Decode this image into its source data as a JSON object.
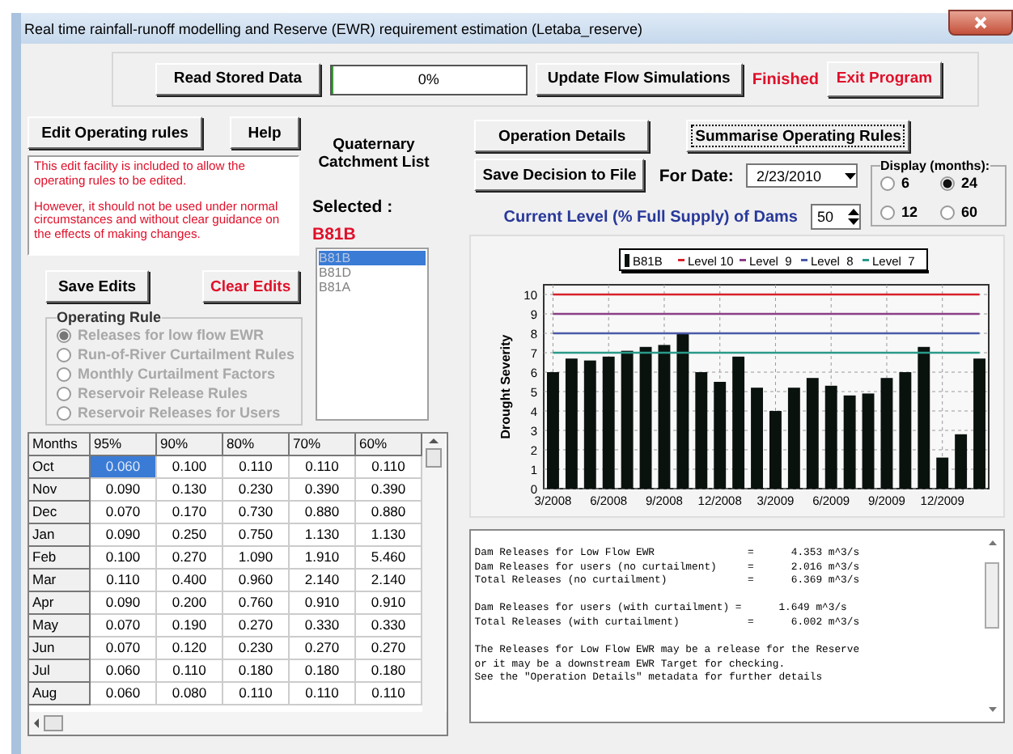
{
  "window": {
    "title": "Real time rainfall-runoff modelling and Reserve (EWR) requirement estimation (Letaba_reserve)"
  },
  "top_bar": {
    "read_button": "Read Stored Data",
    "progress": {
      "text": "0%",
      "level": 0
    },
    "update_button": "Update Flow Simulations",
    "status": "Finished",
    "exit_button": "Exit Program"
  },
  "edit_buttons": [
    "Edit Operating rules",
    "Help"
  ],
  "notice": [
    "This edit facility is included to allow the operating rules to be edited.",
    "However, it should not be used under normal circumstances and without clear guidance on the effects of making changes."
  ],
  "save_button": "Save Edits",
  "clear_button": "Clear Edits",
  "operating_rule": {
    "title": "Operating Rule",
    "options": [
      {
        "label": "Releases for low flow EWR",
        "selected": true,
        "disabled": true
      },
      {
        "label": "Run-of-River Curtailment Rules",
        "selected": false,
        "disabled": true
      },
      {
        "label": "Monthly Curtailment Factors",
        "selected": false,
        "disabled": true
      },
      {
        "label": "Reservoir Release Rules",
        "selected": false,
        "disabled": true
      },
      {
        "label": "Reservoir Releases for Users",
        "selected": false,
        "disabled": true
      }
    ]
  },
  "catchment": {
    "title": "Quaternary Catchment List",
    "selected_label": "Selected :",
    "selected_value": "B81B",
    "items": [
      {
        "label": "B81B",
        "selected": true
      },
      {
        "label": "B81D",
        "selected": false
      },
      {
        "label": "B81A",
        "selected": false
      }
    ]
  },
  "table": {
    "columns": [
      "Months",
      "95%",
      "90%",
      "80%",
      "70%",
      "60%"
    ],
    "rows": [
      {
        "month": "Oct",
        "cells": [
          {
            "v": "0.060",
            "selected": true
          },
          {
            "v": "0.100",
            "selected": false
          },
          {
            "v": "0.110",
            "selected": false
          },
          {
            "v": "0.110",
            "selected": false
          },
          {
            "v": "0.110",
            "selected": false
          }
        ]
      },
      {
        "month": "Nov",
        "cells": [
          {
            "v": "0.090",
            "selected": false
          },
          {
            "v": "0.130",
            "selected": false
          },
          {
            "v": "0.230",
            "selected": false
          },
          {
            "v": "0.390",
            "selected": false
          },
          {
            "v": "0.390",
            "selected": false
          }
        ]
      },
      {
        "month": "Dec",
        "cells": [
          {
            "v": "0.070",
            "selected": false
          },
          {
            "v": "0.170",
            "selected": false
          },
          {
            "v": "0.730",
            "selected": false
          },
          {
            "v": "0.880",
            "selected": false
          },
          {
            "v": "0.880",
            "selected": false
          }
        ]
      },
      {
        "month": "Jan",
        "cells": [
          {
            "v": "0.090",
            "selected": false
          },
          {
            "v": "0.250",
            "selected": false
          },
          {
            "v": "0.750",
            "selected": false
          },
          {
            "v": "1.130",
            "selected": false
          },
          {
            "v": "1.130",
            "selected": false
          }
        ]
      },
      {
        "month": "Feb",
        "cells": [
          {
            "v": "0.100",
            "selected": false
          },
          {
            "v": "0.270",
            "selected": false
          },
          {
            "v": "1.090",
            "selected": false
          },
          {
            "v": "1.910",
            "selected": false
          },
          {
            "v": "5.460",
            "selected": false
          }
        ]
      },
      {
        "month": "Mar",
        "cells": [
          {
            "v": "0.110",
            "selected": false
          },
          {
            "v": "0.400",
            "selected": false
          },
          {
            "v": "0.960",
            "selected": false
          },
          {
            "v": "2.140",
            "selected": false
          },
          {
            "v": "2.140",
            "selected": false
          }
        ]
      },
      {
        "month": "Apr",
        "cells": [
          {
            "v": "0.090",
            "selected": false
          },
          {
            "v": "0.200",
            "selected": false
          },
          {
            "v": "0.760",
            "selected": false
          },
          {
            "v": "0.910",
            "selected": false
          },
          {
            "v": "0.910",
            "selected": false
          }
        ]
      },
      {
        "month": "May",
        "cells": [
          {
            "v": "0.070",
            "selected": false
          },
          {
            "v": "0.190",
            "selected": false
          },
          {
            "v": "0.270",
            "selected": false
          },
          {
            "v": "0.330",
            "selected": false
          },
          {
            "v": "0.330",
            "selected": false
          }
        ]
      },
      {
        "month": "Jun",
        "cells": [
          {
            "v": "0.070",
            "selected": false
          },
          {
            "v": "0.120",
            "selected": false
          },
          {
            "v": "0.230",
            "selected": false
          },
          {
            "v": "0.270",
            "selected": false
          },
          {
            "v": "0.270",
            "selected": false
          }
        ]
      },
      {
        "month": "Jul",
        "cells": [
          {
            "v": "0.060",
            "selected": false
          },
          {
            "v": "0.110",
            "selected": false
          },
          {
            "v": "0.180",
            "selected": false
          },
          {
            "v": "0.180",
            "selected": false
          },
          {
            "v": "0.180",
            "selected": false
          }
        ]
      },
      {
        "month": "Aug",
        "cells": [
          {
            "v": "0.060",
            "selected": false
          },
          {
            "v": "0.080",
            "selected": false
          },
          {
            "v": "0.110",
            "selected": false
          },
          {
            "v": "0.110",
            "selected": false
          },
          {
            "v": "0.110",
            "selected": false
          }
        ]
      }
    ]
  },
  "right_buttons": [
    "Operation Details",
    "Summarise Operating Rules"
  ],
  "save_decision_button": "Save Decision to File",
  "date": {
    "label": "For Date:",
    "value": "2/23/2010"
  },
  "display": {
    "title": "Display (months):",
    "options": [
      {
        "label": "6",
        "selected": false
      },
      {
        "label": "24",
        "selected": true
      },
      {
        "label": "12",
        "selected": false
      },
      {
        "label": "60",
        "selected": false
      }
    ]
  },
  "dam_level": {
    "label": "Current Level (% Full Supply) of Dams",
    "value": "50"
  },
  "chart": {
    "chart_data": {
      "type": "bar",
      "ylabel": "Drought Severity",
      "categories": [
        "3/2008",
        null,
        null,
        "6/2008",
        null,
        null,
        "9/2008",
        null,
        null,
        "12/2008",
        null,
        null,
        "3/2009",
        null,
        null,
        "6/2009",
        null,
        null,
        "9/2009",
        null,
        null,
        "12/2009",
        null,
        null
      ],
      "yticks": [
        0,
        1,
        2,
        3,
        4,
        5,
        6,
        7,
        8,
        9,
        10
      ],
      "ylim": [
        0,
        10.5
      ],
      "grid": true,
      "legend": true,
      "series": [
        {
          "name": "B81B",
          "color": "#0a120e",
          "values": [
            6.0,
            6.7,
            6.6,
            6.8,
            7.1,
            7.3,
            7.4,
            8.0,
            6.0,
            5.5,
            6.8,
            5.2,
            4.0,
            5.2,
            5.7,
            5.3,
            4.8,
            4.9,
            5.7,
            6.0,
            7.3,
            1.6,
            2.8,
            6.7
          ]
        },
        {
          "name": "Level 10",
          "type": "line",
          "color": "#d8202c",
          "values": [
            10,
            10,
            10,
            10,
            10,
            10,
            10,
            10,
            10,
            10,
            10,
            10,
            10,
            10,
            10,
            10,
            10,
            10,
            10,
            10,
            10,
            10,
            10,
            10
          ]
        },
        {
          "name": "Level  9",
          "type": "line",
          "color": "#8a3f86",
          "values": [
            9,
            9,
            9,
            9,
            9,
            9,
            9,
            9,
            9,
            9,
            9,
            9,
            9,
            9,
            9,
            9,
            9,
            9,
            9,
            9,
            9,
            9,
            9,
            9
          ]
        },
        {
          "name": "Level  8",
          "type": "line",
          "color": "#4a5aa8",
          "values": [
            8,
            8,
            8,
            8,
            8,
            8,
            8,
            8,
            8,
            8,
            8,
            8,
            8,
            8,
            8,
            8,
            8,
            8,
            8,
            8,
            8,
            8,
            8,
            8
          ]
        },
        {
          "name": "Level  7",
          "type": "line",
          "color": "#2a9a8a",
          "values": [
            7,
            7,
            7,
            7,
            7,
            7,
            7,
            7,
            7,
            7,
            7,
            7,
            7,
            7,
            7,
            7,
            7,
            7,
            7,
            7,
            7,
            7,
            7,
            7
          ]
        }
      ]
    }
  },
  "output": [
    [
      "Dam Releases for Low Flow EWR               =      4.353 m^3/s",
      "Dam Releases for users (no curtailment)     =      2.016 m^3/s",
      "Total Releases (no curtailment)             =      6.369 m^3/s"
    ],
    [
      "Dam Releases for users (with curtailment) =      1.649 m^3/s",
      "Total Releases (with curtailment)           =      6.002 m^3/s"
    ],
    [
      "The Releases for Low Flow EWR may be a release for the Reserve",
      "or it may be a downstream EWR Target for checking.",
      "See the \"Operation Details\" metadata for further details"
    ]
  ]
}
